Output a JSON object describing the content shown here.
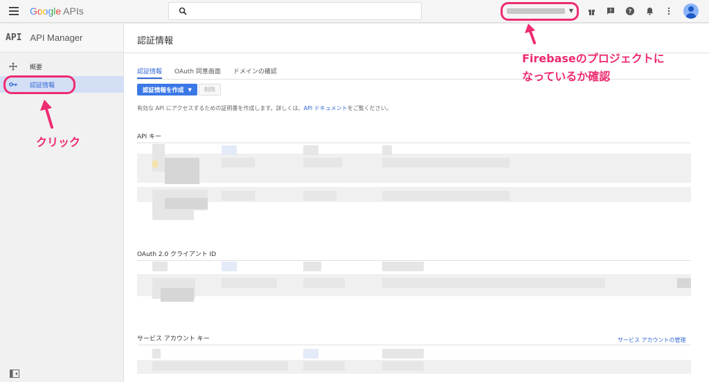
{
  "header": {
    "logo_google": "Google",
    "logo_apis": "APIs",
    "search_placeholder": "",
    "icons": [
      "menu-icon",
      "search-icon",
      "gift-icon",
      "feedback-icon",
      "help-icon",
      "notifications-icon",
      "more-vert-icon",
      "account-avatar"
    ]
  },
  "sidebar": {
    "api_mark": "API",
    "title": "API Manager",
    "items": [
      {
        "label": "概要",
        "icon": "dashboard-icon",
        "active": false
      },
      {
        "label": "認証情報",
        "icon": "key-icon",
        "active": true
      }
    ]
  },
  "main": {
    "page_title": "認証情報",
    "tabs": [
      {
        "label": "認証情報",
        "active": true
      },
      {
        "label": "OAuth 同意画面",
        "active": false
      },
      {
        "label": "ドメインの確認",
        "active": false
      }
    ],
    "create_button": "認証情報を作成",
    "delete_button": "削除",
    "description_prefix": "有効な API にアクセスするための証明書を作成します。詳しくは、",
    "description_link": "API ドキュメント",
    "description_suffix": "をご覧ください。",
    "sections": {
      "api_keys": "API キー",
      "oauth": "OAuth 2.0 クライアント ID",
      "service_accounts": "サービス アカウント キー"
    },
    "manage_service_accounts": "サービス アカウントの管理"
  },
  "annotations": {
    "project_note_line1": "Firebaseのプロジェクトに",
    "project_note_line2": "なっているか確認",
    "click_note": "クリック",
    "color": "#ee2a72"
  }
}
